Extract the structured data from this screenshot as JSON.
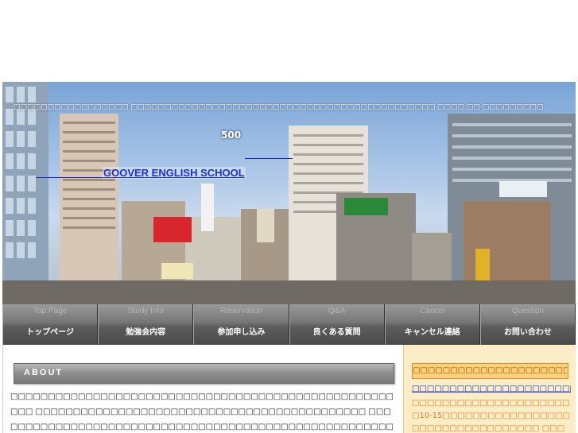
{
  "header": {
    "tagline": "□□□□□□□□□□□□□□□□□ □□□□□□□□□□□□□□□□□□□□□□□□□□□□□□□□□□□□□□□□□□□□□ □□□□ □□ □□□□□□□□□",
    "number": "500",
    "school_name": "GOOVER ENGLISH SCHOOL"
  },
  "nav": {
    "items": [
      {
        "en": "Top Page",
        "jp": "トップページ"
      },
      {
        "en": "Study Info",
        "jp": "勉強会内容"
      },
      {
        "en": "Reservation",
        "jp": "参加申し込み"
      },
      {
        "en": "Q&A",
        "jp": "良くある質問"
      },
      {
        "en": "Cancel",
        "jp": "キャンセル連絡"
      },
      {
        "en": "Question",
        "jp": "お問い合わせ"
      }
    ]
  },
  "about": {
    "title": "ABOUT",
    "text": "□□□□□□□□□□□□□□□□□□□□□□□□□□□□□□□□□□□□□□□□□□□□□□□□□□□□□□ □□□□□□□□□□□□□□□□□□□□□□□□□□□□□□□□□□□□□□□□□□□□ □□□□□□□□□□□□□□□□□□□□□□□□□□□□□□□□□□□□□□□□□□□□□□□□□□□□□□□□□□□□□□□□□□□□□□□□□□□□□ □□□□□□□□□□□□□□□□□□□□□□□□□□□□□□□□□□□□□□□□□□□□□□□□□□□□□□□□□□□□□□□□□□□□□□□□□□□□□□□□□□□□□□□□□□□□□□□□□□□□□□□□□□□□□□□□□□□□□ □□□□ □□□□□□□□□□□□□□□□□□□□□□□□□□□□"
  },
  "sidebar": {
    "header": "□□□□□□□□□□□□□□□□□□□□□□",
    "link": "□□□□□□□□□□□□□□□□□□□□□□□□□□□□□□□□",
    "text": "□□□□□□□□□□□□□□□□□□□□□□10-15□□□□□□□□□□□□□□□□□□□□□□□□□□□□□□□□□□ □□□□□□□□□□□□□□□□□□□□□□□□□□□□□□□"
  }
}
